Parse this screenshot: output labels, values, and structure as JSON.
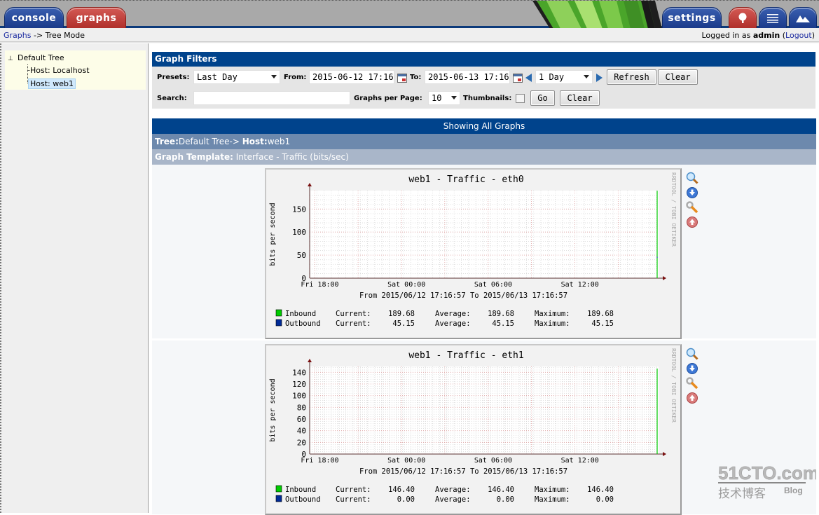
{
  "nav": {
    "tabs": [
      {
        "label": "console",
        "active": false
      },
      {
        "label": "graphs",
        "active": true
      },
      {
        "label": "settings",
        "active": false
      }
    ],
    "view_icons": [
      "tree-view-icon",
      "list-view-icon",
      "preview-view-icon"
    ]
  },
  "breadcrumb": {
    "link": "Graphs",
    "separator": "->",
    "current": "Tree Mode"
  },
  "login": {
    "prefix": "Logged in as",
    "user": "admin",
    "logout_label": "Logout"
  },
  "tree": {
    "root": "Default Tree",
    "hosts": [
      {
        "label": "Host: Localhost",
        "selected": false
      },
      {
        "label": "Host: web1",
        "selected": true
      }
    ]
  },
  "filters": {
    "title": "Graph Filters",
    "presets_label": "Presets:",
    "presets_value": "Last Day",
    "from_label": "From:",
    "from_value": "2015-06-12 17:16",
    "to_label": "To:",
    "to_value": "2015-06-13 17:16",
    "timespan_value": "1 Day",
    "refresh_label": "Refresh",
    "clear_label": "Clear",
    "search_label": "Search:",
    "search_value": "",
    "gpp_label": "Graphs per Page:",
    "gpp_value": "10",
    "thumbnails_label": "Thumbnails:",
    "thumbnails_checked": false,
    "go_label": "Go",
    "clear2_label": "Clear"
  },
  "results": {
    "showing": "Showing All Graphs",
    "tree_label": "Tree:",
    "tree_value": "Default Tree->",
    "host_label": "Host:",
    "host_value": "web1",
    "template_label": "Graph Template:",
    "template_value": "Interface - Traffic (bits/sec)"
  },
  "graphs": [
    {
      "title": "web1 - Traffic - eth0",
      "ylabel": "bits per second",
      "yticks": [
        "0",
        "50",
        "100",
        "150"
      ],
      "ymax": 190,
      "tick_values": [
        0,
        50,
        100,
        150
      ],
      "xticks": [
        "Fri 18:00",
        "Sat 00:00",
        "Sat 06:00",
        "Sat 12:00"
      ],
      "range_text": "From 2015/06/12 17:16:57 To 2015/06/13 17:16:57",
      "watermark": "RRDTOOL / TOBI OETIKER",
      "legend": [
        {
          "name": "Inbound",
          "color": "#00cc00",
          "current": "189.68",
          "average": "189.68",
          "maximum": "189.68"
        },
        {
          "name": "Outbound",
          "color": "#002a97",
          "current": "45.15",
          "average": "45.15",
          "maximum": "45.15"
        }
      ],
      "legend_labels": {
        "current": "Current:",
        "average": "Average:",
        "maximum": "Maximum:"
      }
    },
    {
      "title": "web1 - Traffic - eth1",
      "ylabel": "bits per second",
      "yticks": [
        "0",
        "20",
        "40",
        "60",
        "80",
        "100",
        "120",
        "140"
      ],
      "ymax": 150,
      "tick_values": [
        0,
        20,
        40,
        60,
        80,
        100,
        120,
        140
      ],
      "xticks": [
        "Fri 18:00",
        "Sat 00:00",
        "Sat 06:00",
        "Sat 12:00"
      ],
      "range_text": "From 2015/06/12 17:16:57 To 2015/06/13 17:16:57",
      "watermark": "RRDTOOL / TOBI OETIKER",
      "legend": [
        {
          "name": "Inbound",
          "color": "#00cc00",
          "current": "146.40",
          "average": "146.40",
          "maximum": "146.40"
        },
        {
          "name": "Outbound",
          "color": "#002a97",
          "current": "0.00",
          "average": "0.00",
          "maximum": "0.00"
        }
      ],
      "legend_labels": {
        "current": "Current:",
        "average": "Average:",
        "maximum": "Maximum:"
      }
    }
  ],
  "graph_actions": [
    "zoom-icon",
    "export-icon",
    "properties-icon",
    "move-up-icon"
  ],
  "watermark_site": {
    "brand": "51CTO.com",
    "sub": "技术博客",
    "blog": "Blog"
  },
  "colors": {
    "header_blue": "#00438c",
    "tree_bar": "#6d89ad",
    "template_bar": "#a9b6c9",
    "inbound": "#00cc00",
    "outbound": "#002a97"
  }
}
